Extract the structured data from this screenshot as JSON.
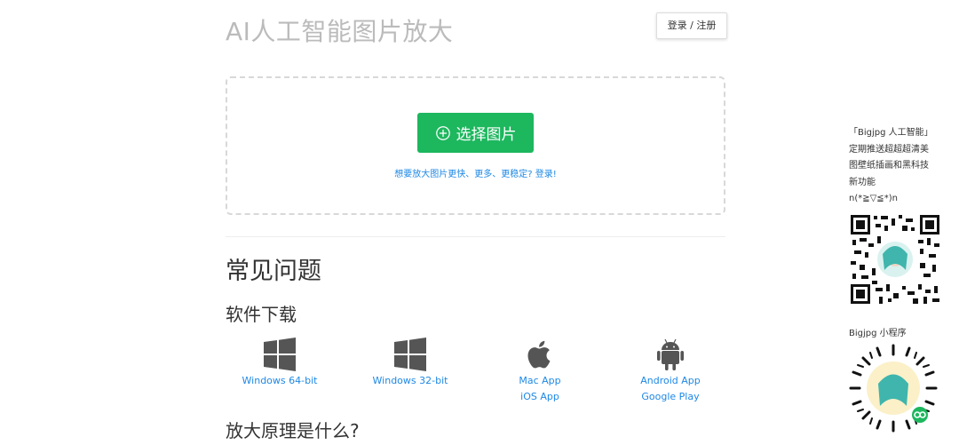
{
  "header": {
    "title": "AI人工智能图片放大",
    "login_label": "登录 / 注册"
  },
  "upload": {
    "button_label": "选择图片",
    "hint": "想要放大图片更快、更多、更稳定? 登录!"
  },
  "faq": {
    "title": "常见问题",
    "download_title": "软件下载",
    "principle_title": "放大原理是什么?"
  },
  "downloads": [
    {
      "icon": "windows-icon",
      "links": [
        "Windows 64-bit"
      ]
    },
    {
      "icon": "windows-icon",
      "links": [
        "Windows 32-bit"
      ]
    },
    {
      "icon": "apple-icon",
      "links": [
        "Mac App",
        "iOS App"
      ]
    },
    {
      "icon": "android-icon",
      "links": [
        "Android App",
        "Google Play"
      ]
    }
  ],
  "sidebar": {
    "lines": [
      "「Bigjpg 人工智能」",
      "定期推送超超超清美",
      "图壁纸插画和黑科技",
      "新功能",
      "n(*≧▽≦*)n"
    ],
    "mini_program_label": "Bigjpg 小程序"
  },
  "colors": {
    "accent_green": "#1db75e",
    "link_blue": "#1e88e5"
  }
}
